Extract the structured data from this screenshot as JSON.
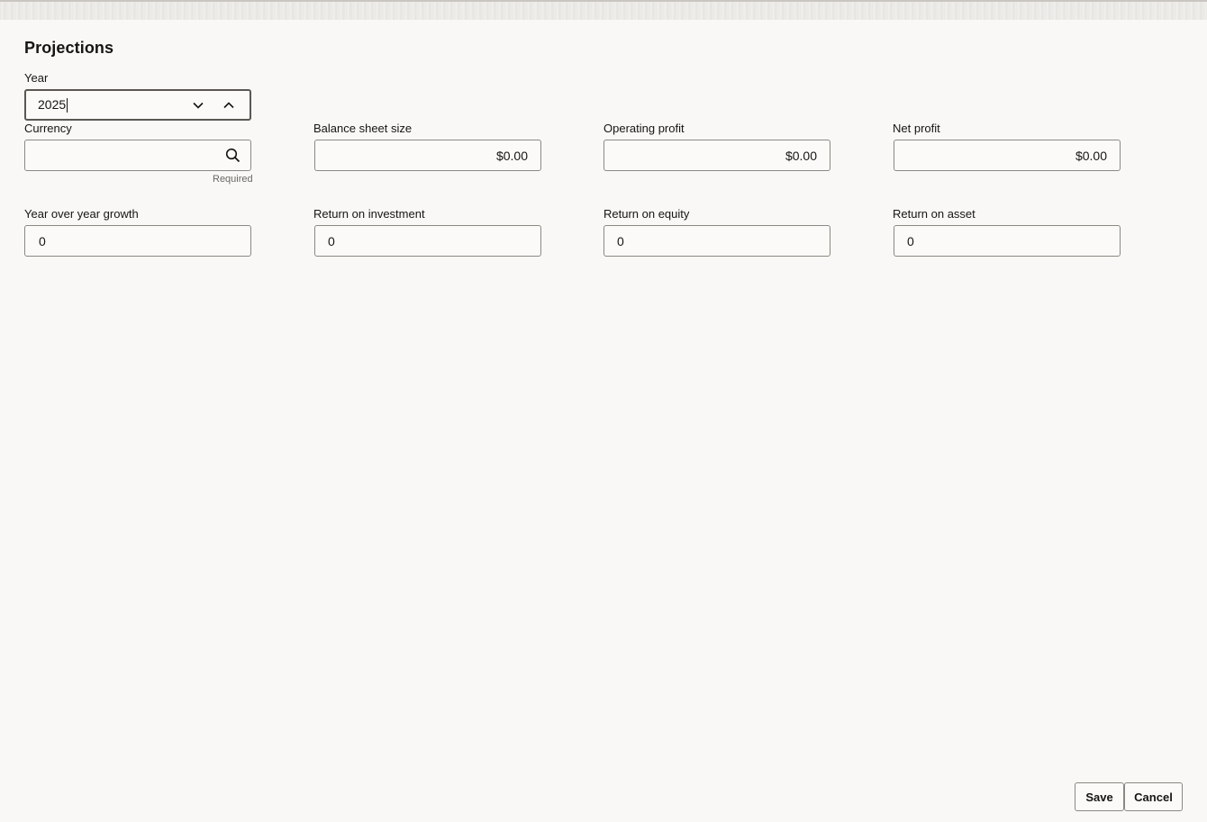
{
  "page": {
    "title": "Projections"
  },
  "year": {
    "label": "Year",
    "value": "2025"
  },
  "currency": {
    "label": "Currency",
    "value": "",
    "helper": "Required"
  },
  "balance_sheet_size": {
    "label": "Balance sheet size",
    "value": "$0.00"
  },
  "operating_profit": {
    "label": "Operating profit",
    "value": "$0.00"
  },
  "net_profit": {
    "label": "Net profit",
    "value": "$0.00"
  },
  "yoy_growth": {
    "label": "Year over year growth",
    "value": "0"
  },
  "return_on_investment": {
    "label": "Return on investment",
    "value": "0"
  },
  "return_on_equity": {
    "label": "Return on equity",
    "value": "0"
  },
  "return_on_asset": {
    "label": "Return on asset",
    "value": "0"
  },
  "actions": {
    "save": "Save",
    "cancel": "Cancel"
  },
  "icons": {
    "year_decrement": "chevron-down-icon",
    "year_increment": "chevron-up-icon",
    "currency_search": "search-icon"
  }
}
